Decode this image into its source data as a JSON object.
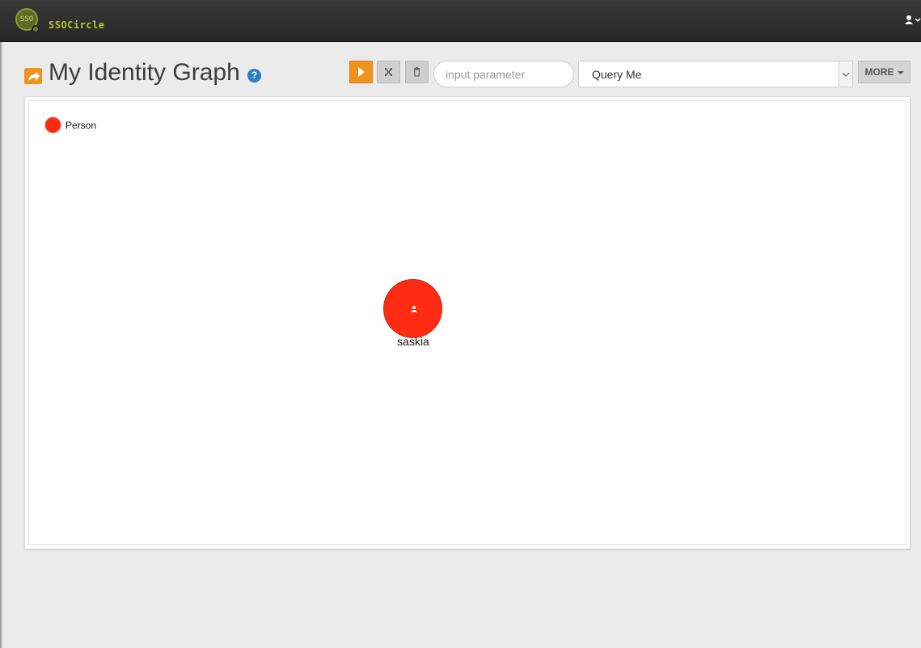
{
  "app": {
    "logo_mark": "SSO",
    "brand_name": "SSOCircle",
    "user_menu_icon": "user-icon"
  },
  "header": {
    "title": "My Identity Graph",
    "title_icon": "share-arrow-icon",
    "help_icon": "question-circle-icon",
    "help_glyph": "?"
  },
  "toolbar": {
    "run_icon": "play-icon",
    "fit_icon": "expand-arrows-icon",
    "delete_icon": "trash-icon",
    "parameter_placeholder": "input parameter",
    "query_selected": "Query Me",
    "more_label": "MORE"
  },
  "graph": {
    "legend": [
      {
        "label": "Person",
        "color": "#ff2b12"
      }
    ],
    "nodes": [
      {
        "label": "saskia",
        "type": "Person",
        "color": "#ff2b12",
        "icon": "user-icon"
      }
    ]
  },
  "colors": {
    "topbar": "#2e2e2e",
    "brand": "#b3c534",
    "accent": "#f0931e",
    "help": "#2d7fc1",
    "node": "#ff2b12"
  }
}
